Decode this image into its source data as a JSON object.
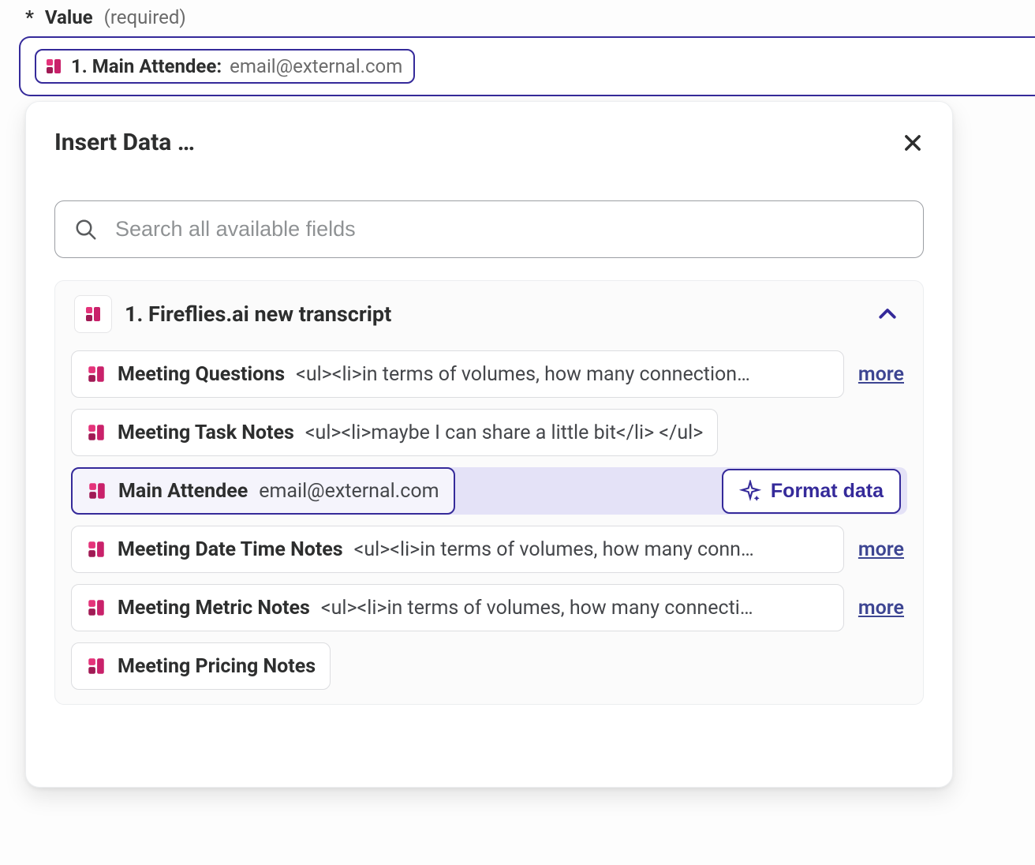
{
  "field": {
    "label": "Value",
    "required_text": "(required)"
  },
  "pill": {
    "name": "1. Main Attendee:",
    "value": "email@external.com"
  },
  "panel": {
    "title": "Insert Data …",
    "search_placeholder": "Search all available fields",
    "section_title": "1. Fireflies.ai new transcript",
    "format_label": "Format data",
    "more_label": "more",
    "items": [
      {
        "name": "Meeting Questions",
        "value": "<ul><li>in terms of volumes, how many connection…",
        "has_more": true,
        "layout": "full",
        "selected": false
      },
      {
        "name": "Meeting Task Notes",
        "value": "<ul><li>maybe I can share a little bit</li> </ul>",
        "has_more": false,
        "layout": "auto",
        "selected": false
      },
      {
        "name": "Main Attendee",
        "value": "email@external.com",
        "has_more": false,
        "layout": "auto",
        "selected": true
      },
      {
        "name": "Meeting Date Time Notes",
        "value": "<ul><li>in terms of volumes, how many conn…",
        "has_more": true,
        "layout": "full",
        "selected": false
      },
      {
        "name": "Meeting Metric Notes",
        "value": "<ul><li>in terms of volumes, how many connecti…",
        "has_more": true,
        "layout": "full",
        "selected": false
      },
      {
        "name": "Meeting Pricing Notes",
        "value": "",
        "has_more": false,
        "layout": "auto",
        "selected": false
      }
    ]
  },
  "icons": {
    "fireflies": "fireflies-icon",
    "close": "close-icon",
    "search": "search-icon",
    "chevron_up": "chevron-up-icon",
    "sparkle": "sparkle-icon"
  }
}
